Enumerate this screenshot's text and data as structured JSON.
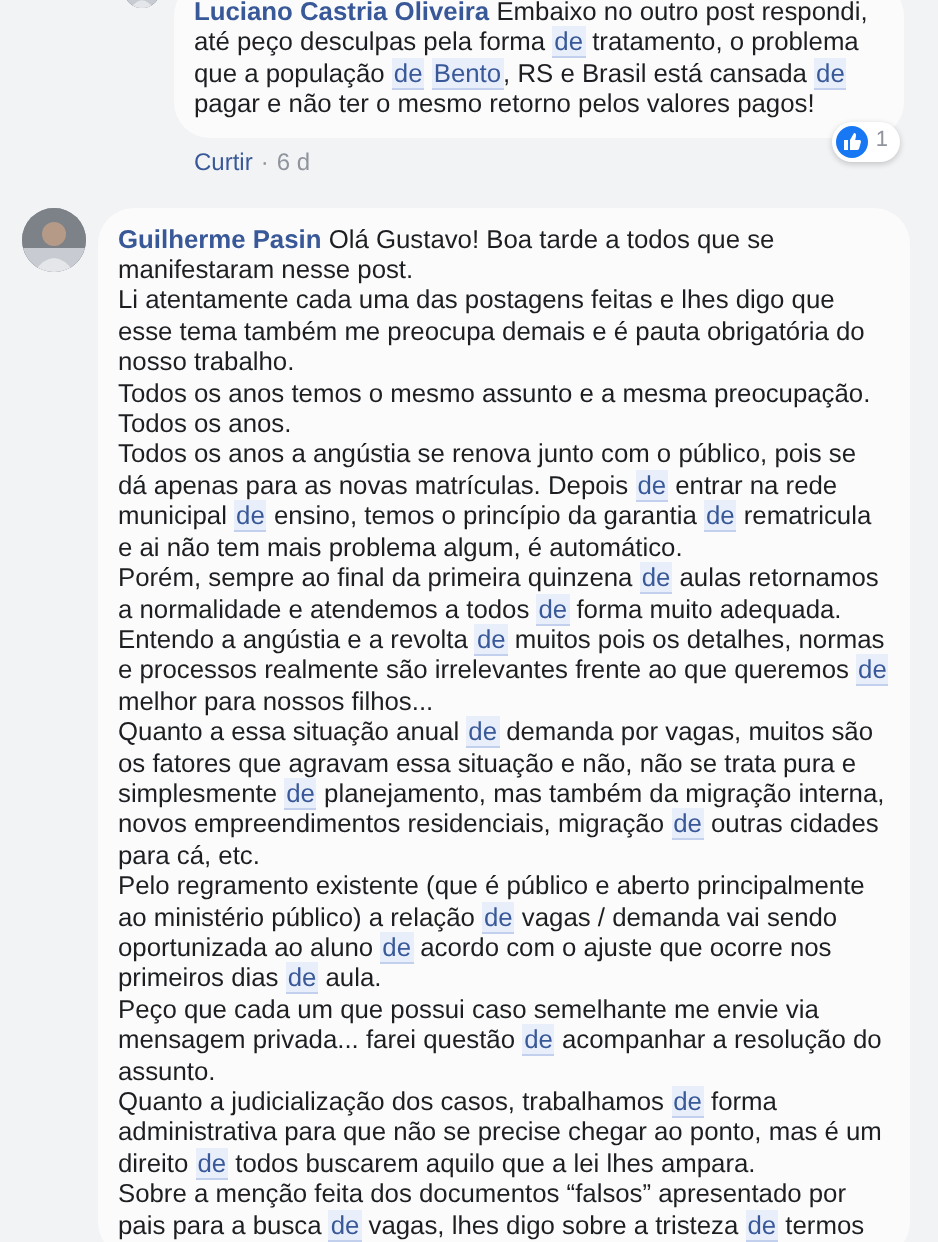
{
  "comments": [
    {
      "kind": "reply",
      "author": "Luciano Castria Oliveira",
      "paragraphs": [
        [
          {
            "kind": "text",
            "text": "Embaixo no outro post respondi, até peço desculpas pela forma "
          },
          {
            "kind": "link",
            "text": "de"
          },
          {
            "kind": "text",
            "text": " tratamento, o problema que a população "
          },
          {
            "kind": "link",
            "text": "de"
          },
          {
            "kind": "link",
            "text": "Bento",
            "gap_before": true
          },
          {
            "kind": "text",
            "text": ", RS e Brasil está cansada "
          },
          {
            "kind": "link",
            "text": "de"
          },
          {
            "kind": "text",
            "text": " pagar e não ter o mesmo retorno pelos valores pagos!"
          }
        ]
      ],
      "actions": [
        {
          "label": "Curtir"
        }
      ],
      "separator": "·",
      "time": "6 d",
      "reactions": {
        "count": "1"
      }
    },
    {
      "kind": "comment",
      "author": "Guilherme Pasin",
      "paragraphs": [
        [
          {
            "kind": "text",
            "text": "Olá Gustavo! Boa tarde a todos que se manifestaram nesse post."
          }
        ],
        [
          {
            "kind": "text",
            "text": "Li atentamente cada uma das postagens feitas e lhes digo que esse tema também me preocupa demais e é pauta obrigatória do nosso trabalho."
          }
        ],
        [
          {
            "kind": "text",
            "text": "Todos os anos temos o mesmo assunto e a mesma preocupação."
          }
        ],
        [
          {
            "kind": "text",
            "text": "Todos os anos."
          }
        ],
        [
          {
            "kind": "text",
            "text": "Todos os anos a angústia se renova junto com o público, pois se dá apenas para as novas matrículas. Depois "
          },
          {
            "kind": "link",
            "text": "de"
          },
          {
            "kind": "text",
            "text": " entrar na rede municipal "
          },
          {
            "kind": "link",
            "text": "de"
          },
          {
            "kind": "text",
            "text": " ensino, temos o princípio da garantia "
          },
          {
            "kind": "link",
            "text": "de"
          },
          {
            "kind": "text",
            "text": " rematricula e ai não tem mais problema algum, é automático."
          }
        ],
        [
          {
            "kind": "text",
            "text": "Porém, sempre ao final da primeira quinzena "
          },
          {
            "kind": "link",
            "text": "de"
          },
          {
            "kind": "text",
            "text": " aulas retornamos a normalidade e atendemos a todos "
          },
          {
            "kind": "link",
            "text": "de"
          },
          {
            "kind": "text",
            "text": " forma muito adequada."
          }
        ],
        [
          {
            "kind": "text",
            "text": "Entendo a angústia e a revolta "
          },
          {
            "kind": "link",
            "text": "de"
          },
          {
            "kind": "text",
            "text": " muitos pois os detalhes, normas e processos realmente são irrelevantes frente ao que queremos "
          },
          {
            "kind": "link",
            "text": "de"
          },
          {
            "kind": "text",
            "text": " melhor para nossos filhos..."
          }
        ],
        [
          {
            "kind": "text",
            "text": "Quanto a essa situação anual "
          },
          {
            "kind": "link",
            "text": "de"
          },
          {
            "kind": "text",
            "text": " demanda por vagas, muitos são os fatores que agravam essa situação e não, não se trata pura e simplesmente "
          },
          {
            "kind": "link",
            "text": "de"
          },
          {
            "kind": "text",
            "text": " planejamento, mas também da migração interna, novos empreendimentos residenciais, migração "
          },
          {
            "kind": "link",
            "text": "de"
          },
          {
            "kind": "text",
            "text": " outras cidades para cá, etc."
          }
        ],
        [
          {
            "kind": "text",
            "text": "Pelo regramento existente (que é público e aberto principalmente ao ministério público) a relação "
          },
          {
            "kind": "link",
            "text": "de"
          },
          {
            "kind": "text",
            "text": " vagas / demanda vai sendo oportunizada ao aluno "
          },
          {
            "kind": "link",
            "text": "de"
          },
          {
            "kind": "text",
            "text": " acordo com o ajuste que ocorre nos primeiros dias "
          },
          {
            "kind": "link",
            "text": "de"
          },
          {
            "kind": "text",
            "text": " aula."
          }
        ],
        [
          {
            "kind": "text",
            "text": "Peço que cada um que possui caso semelhante me envie via mensagem privada... farei questão "
          },
          {
            "kind": "link",
            "text": "de"
          },
          {
            "kind": "text",
            "text": " acompanhar a resolução do assunto."
          }
        ],
        [
          {
            "kind": "text",
            "text": "Quanto a judicialização dos casos, trabalhamos "
          },
          {
            "kind": "link",
            "text": "de"
          },
          {
            "kind": "text",
            "text": " forma administrativa para que não se precise chegar ao ponto, mas é um direito "
          },
          {
            "kind": "link",
            "text": "de"
          },
          {
            "kind": "text",
            "text": " todos buscarem aquilo que a lei lhes ampara."
          }
        ],
        [
          {
            "kind": "text",
            "text": "Sobre a menção feita dos documentos “falsos” apresentado por pais para a busca "
          },
          {
            "kind": "link",
            "text": "de"
          },
          {
            "kind": "text",
            "text": " vagas, lhes digo sobre a tristeza "
          },
          {
            "kind": "link",
            "text": "de"
          },
          {
            "kind": "text",
            "text": " termos"
          }
        ]
      ]
    }
  ]
}
